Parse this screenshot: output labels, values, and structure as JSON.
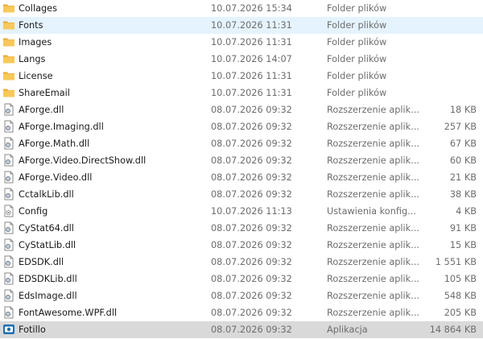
{
  "colors": {
    "folder": "#f7c85b",
    "folder_dark": "#e8a93a",
    "hover": "#e5f3ff",
    "selected": "#d9d9d9",
    "app_icon": "#1f6fb0"
  },
  "files": [
    {
      "name": "Collages",
      "date": "10.07.2026 15:34",
      "type": "Folder plików",
      "size": "",
      "icon": "folder-icon"
    },
    {
      "name": "Fonts",
      "date": "10.07.2026 11:31",
      "type": "Folder plików",
      "size": "",
      "icon": "folder-icon",
      "state": "hovered"
    },
    {
      "name": "Images",
      "date": "10.07.2026 11:31",
      "type": "Folder plików",
      "size": "",
      "icon": "folder-icon"
    },
    {
      "name": "Langs",
      "date": "10.07.2026 14:07",
      "type": "Folder plików",
      "size": "",
      "icon": "folder-icon"
    },
    {
      "name": "License",
      "date": "10.07.2026 11:31",
      "type": "Folder plików",
      "size": "",
      "icon": "folder-icon"
    },
    {
      "name": "ShareEmail",
      "date": "10.07.2026 11:31",
      "type": "Folder plików",
      "size": "",
      "icon": "folder-icon"
    },
    {
      "name": "AForge.dll",
      "date": "08.07.2026 09:32",
      "type": "Rozszerzenie aplik...",
      "size": "18 KB",
      "icon": "dll-file-icon"
    },
    {
      "name": "AForge.Imaging.dll",
      "date": "08.07.2026 09:32",
      "type": "Rozszerzenie aplik...",
      "size": "257 KB",
      "icon": "dll-file-icon"
    },
    {
      "name": "AForge.Math.dll",
      "date": "08.07.2026 09:32",
      "type": "Rozszerzenie aplik...",
      "size": "67 KB",
      "icon": "dll-file-icon"
    },
    {
      "name": "AForge.Video.DirectShow.dll",
      "date": "08.07.2026 09:32",
      "type": "Rozszerzenie aplik...",
      "size": "60 KB",
      "icon": "dll-file-icon"
    },
    {
      "name": "AForge.Video.dll",
      "date": "08.07.2026 09:32",
      "type": "Rozszerzenie aplik...",
      "size": "21 KB",
      "icon": "dll-file-icon"
    },
    {
      "name": "CctalkLib.dll",
      "date": "08.07.2026 09:32",
      "type": "Rozszerzenie aplik...",
      "size": "38 KB",
      "icon": "dll-file-icon"
    },
    {
      "name": "Config",
      "date": "10.07.2026 11:13",
      "type": "Ustawienia konfig...",
      "size": "4 KB",
      "icon": "config-file-icon"
    },
    {
      "name": "CyStat64.dll",
      "date": "08.07.2026 09:32",
      "type": "Rozszerzenie aplik...",
      "size": "91 KB",
      "icon": "dll-file-icon"
    },
    {
      "name": "CyStatLib.dll",
      "date": "08.07.2026 09:32",
      "type": "Rozszerzenie aplik...",
      "size": "15 KB",
      "icon": "dll-file-icon"
    },
    {
      "name": "EDSDK.dll",
      "date": "08.07.2026 09:32",
      "type": "Rozszerzenie aplik...",
      "size": "1 551 KB",
      "icon": "dll-file-icon"
    },
    {
      "name": "EDSDKLib.dll",
      "date": "08.07.2026 09:32",
      "type": "Rozszerzenie aplik...",
      "size": "105 KB",
      "icon": "dll-file-icon"
    },
    {
      "name": "EdsImage.dll",
      "date": "08.07.2026 09:32",
      "type": "Rozszerzenie aplik...",
      "size": "548 KB",
      "icon": "dll-file-icon"
    },
    {
      "name": "FontAwesome.WPF.dll",
      "date": "08.07.2026 09:32",
      "type": "Rozszerzenie aplik...",
      "size": "205 KB",
      "icon": "dll-file-icon"
    },
    {
      "name": "Fotillo",
      "date": "08.07.2026 09:32",
      "type": "Aplikacja",
      "size": "14 864 KB",
      "icon": "app-icon",
      "state": "selected"
    }
  ]
}
